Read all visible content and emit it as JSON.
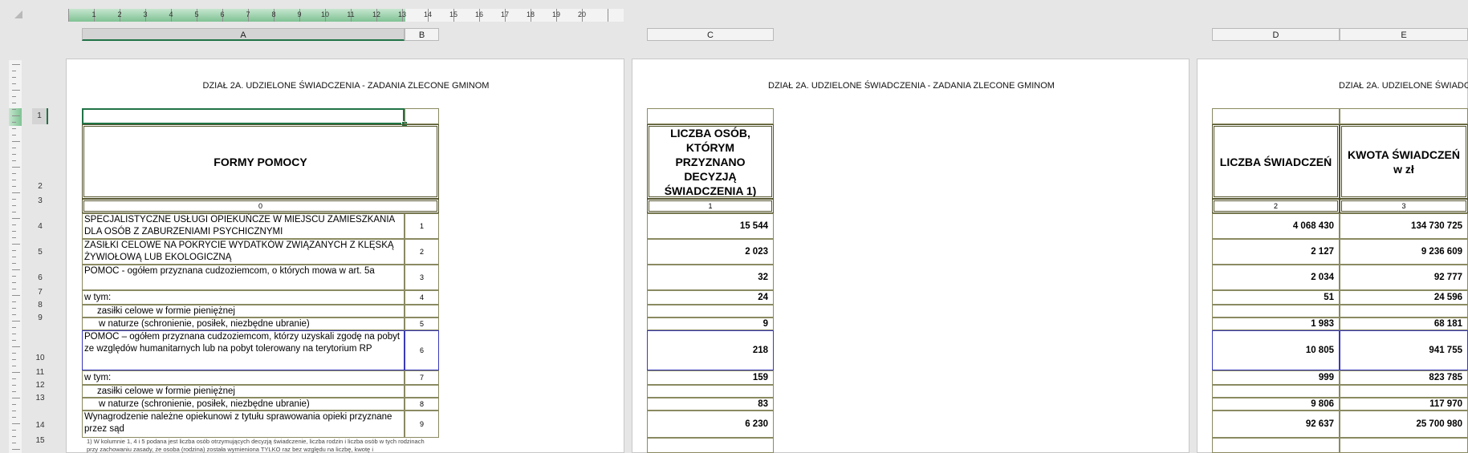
{
  "ruler": {
    "numbers": [
      "1",
      "2",
      "3",
      "4",
      "5",
      "6",
      "7",
      "8",
      "9",
      "10",
      "11",
      "12",
      "13",
      "14",
      "15",
      "16",
      "17",
      "18",
      "19",
      "20"
    ]
  },
  "columns": [
    "A",
    "B",
    "C",
    "D",
    "E"
  ],
  "rows": [
    "1",
    "2",
    "3",
    "4",
    "5",
    "6",
    "7",
    "8",
    "9",
    "10",
    "11",
    "12",
    "13",
    "14",
    "15"
  ],
  "page_title": "DZIAŁ 2A. UDZIELONE ŚWIADCZENIA - ZADANIA ZLECONE GMINOM",
  "page_title_partial": "DZIAŁ 2A. UDZIELONE ŚWIADCZ",
  "headers": {
    "a": "FORMY POMOCY",
    "c": "LICZBA OSÓB, KTÓRYM PRZYZNANO DECYZJĄ ŚWIADCZENIA 1)",
    "d": "LICZBA ŚWIADCZEŃ",
    "e": "KWOTA ŚWIADCZEŃ w zł",
    "idx_a": "0",
    "idx_c": "1",
    "idx_d": "2",
    "idx_e": "3"
  },
  "table": [
    {
      "label": "SPECJALISTYCZNE USŁUGI OPIEKUŃCZE W MIEJSCU ZAMIESZKANIA DLA OSÓB Z ZABURZENIAMI PSYCHICZNYMI",
      "idx": "1",
      "c": "15 544",
      "d": "4 068 430",
      "e": "134 730 725"
    },
    {
      "label": "ZASIŁKI CELOWE NA POKRYCIE WYDATKÓW ZWIĄZANYCH Z KLĘSKĄ ŻYWIOŁOWĄ LUB EKOLOGICZNĄ",
      "idx": "2",
      "c": "2 023",
      "d": "2 127",
      "e": "9 236 609"
    },
    {
      "label": "POMOC - ogółem przyznana cudzoziemcom, o których mowa w art. 5a",
      "idx": "3",
      "c": "32",
      "d": "2 034",
      "e": "92 777"
    },
    {
      "label": "w tym:",
      "idx": "4",
      "c": "24",
      "d": "51",
      "e": "24 596"
    },
    {
      "label": "zasiłki celowe w formie pieniężnej",
      "idx": "",
      "c": "",
      "d": "",
      "e": ""
    },
    {
      "label": "w naturze (schronienie, posiłek, niezbędne ubranie)",
      "idx": "5",
      "c": "9",
      "d": "1 983",
      "e": "68 181"
    },
    {
      "label": "POMOC – ogółem przyznana cudzoziemcom, którzy uzyskali zgodę na pobyt ze względów humanitarnych lub na pobyt tolerowany na terytorium RP",
      "idx": "6",
      "c": "218",
      "d": "10 805",
      "e": "941 755"
    },
    {
      "label": "w tym:",
      "idx": "7",
      "c": "159",
      "d": "999",
      "e": "823 785"
    },
    {
      "label": "zasiłki celowe w formie pieniężnej",
      "idx": "",
      "c": "",
      "d": "",
      "e": ""
    },
    {
      "label": "w naturze (schronienie, posiłek, niezbędne ubranie)",
      "idx": "8",
      "c": "83",
      "d": "9 806",
      "e": "117 970"
    },
    {
      "label": "Wynagrodzenie należne opiekunowi z tytułu sprawowania opieki przyznane przez sąd",
      "idx": "9",
      "c": "6 230",
      "d": "92 637",
      "e": "25 700 980"
    }
  ],
  "footnote": "1) W kolumnie 1, 4 i 5 podana jest liczba osób otrzymujących decyzją świadczenie, liczba rodzin i liczba osób w tych rodzinach przy zachowaniu zasady, że osoba (rodzina) została wymieniona TYLKO raz bez względu na liczbę, kwotę i"
}
